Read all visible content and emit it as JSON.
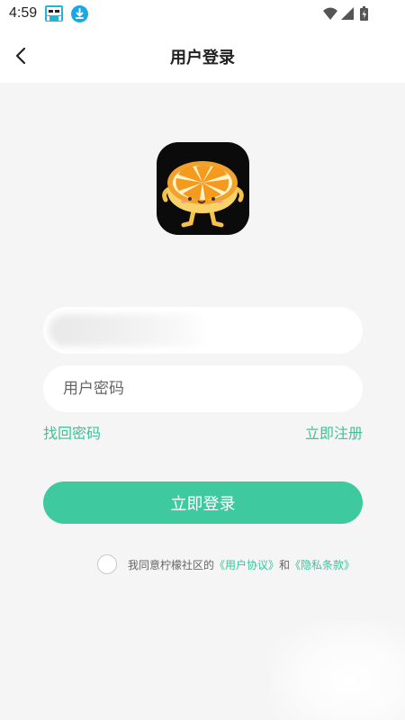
{
  "status_bar": {
    "time": "4:59",
    "app_icon": "cartoon-app-icon",
    "download_icon": "download-icon",
    "wifi_icon": "wifi-icon",
    "signal_icon": "signal-icon",
    "battery_icon": "battery-charging-icon"
  },
  "header": {
    "back_icon": "chevron-left-icon",
    "title": "用户登录"
  },
  "logo": {
    "icon": "orange-slice-mascot-icon"
  },
  "form": {
    "username_value": "",
    "password_placeholder": "用户密码",
    "forgot_password": "找回密码",
    "register": "立即注册",
    "login_button": "立即登录"
  },
  "agreement": {
    "prefix": "我同意柠檬社区的",
    "user_agreement": "《用户协议》",
    "conjunction": "和",
    "privacy_policy": "《隐私条款》"
  },
  "colors": {
    "accent": "#3ec99f",
    "link": "#3cc39a",
    "background": "#f5f5f5"
  }
}
